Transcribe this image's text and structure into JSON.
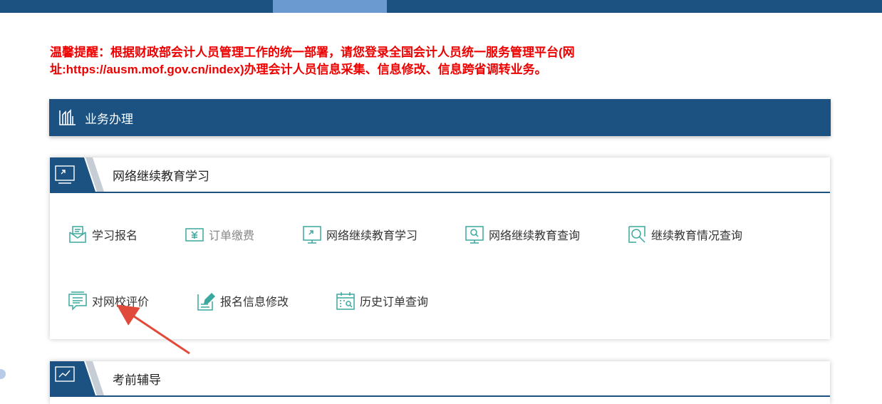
{
  "notice": {
    "line1": "温馨提醒：根据财政部会计人员管理工作的统一部署，请您登录全国会计人员统一服务管理平台(网",
    "line2": "址:https://ausm.mof.gov.cn/index)办理会计人员信息采集、信息修改、信息跨省调转业务。"
  },
  "section": {
    "title": "业务办理",
    "icon": "building-columns-icon"
  },
  "card1": {
    "title": "网络继续教育学习",
    "items": [
      {
        "label": "学习报名",
        "icon": "envelope-icon"
      },
      {
        "label": "订单缴费",
        "icon": "yen-icon"
      },
      {
        "label": "网络继续教育学习",
        "icon": "monitor-icon"
      },
      {
        "label": "网络继续教育查询",
        "icon": "monitor-search-icon"
      },
      {
        "label": "继续教育情况查询",
        "icon": "magnifier-icon"
      },
      {
        "label": "对网校评价",
        "icon": "chat-list-icon"
      },
      {
        "label": "报名信息修改",
        "icon": "edit-doc-icon"
      },
      {
        "label": "历史订单查询",
        "icon": "calendar-search-icon"
      }
    ]
  },
  "card2": {
    "title": "考前辅导"
  },
  "colors": {
    "primary": "#1c5281",
    "accent": "#6a9ad0",
    "notice": "#ee0000",
    "icon": "#3aa89e",
    "arrow": "#e04a3a"
  }
}
